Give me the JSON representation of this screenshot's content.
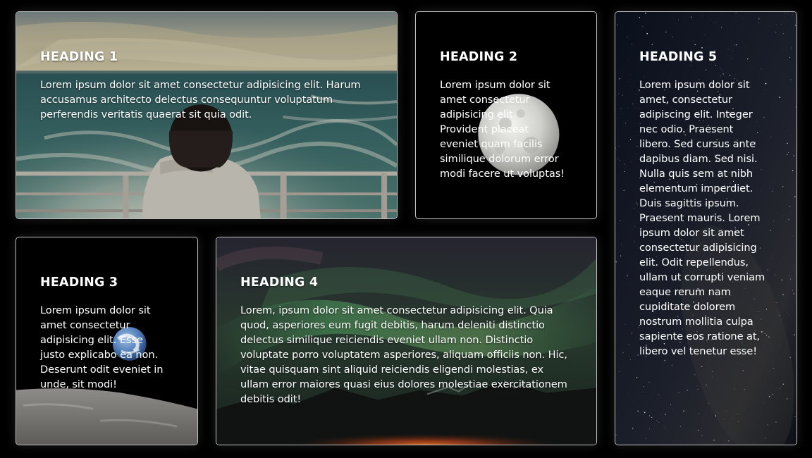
{
  "cards": [
    {
      "heading": "HEADING 1",
      "text": "Lorem ipsum dolor sit amet consectetur adipisicing elit. Harum accusamus architecto delectus consequuntur voluptatum perferendis veritatis quaerat sit quia odit."
    },
    {
      "heading": "HEADING 2",
      "text": "Lorem ipsum dolor sit amet consectetur adipisicing elit. Provident placeat eveniet quam facilis similique dolorum error modi facere ut voluptas!"
    },
    {
      "heading": "HEADING 3",
      "text": "Lorem ipsum dolor sit amet consectetur adipisicing elit. Esse justo explicabo ea non. Deserunt odit eveniet in unde, sit modi!"
    },
    {
      "heading": "HEADING 4",
      "text": "Lorem, ipsum dolor sit amet consectetur adipisicing elit. Quia quod, asperiores eum fugit debitis, harum deleniti distinctio delectus similique reiciendis eveniet ullam non. Distinctio voluptate porro voluptatem asperiores, aliquam officiis non. Hic, vitae quisquam sint aliquid reiciendis eligendi molestias, ex ullam error maiores quasi eius dolores molestiae exercitationem debitis odit!"
    },
    {
      "heading": "HEADING 5",
      "text": "Lorem ipsum dolor sit amet, consectetur adipiscing elit. Integer nec odio. Praesent libero. Sed cursus ante dapibus diam. Sed nisi. Nulla quis sem at nibh elementum imperdiet. Duis sagittis ipsum. Praesent mauris. Lorem ipsum dolor sit amet consectetur adipisicing elit. Odit repellendus, ullam ut corrupti veniam eaque rerum nam cupiditate dolorem nostrum mollitia culpa sapiente eos ratione at, libero vel tenetur esse!"
    }
  ],
  "colors": {
    "page_background": "#000000",
    "card_border": "#ffffff",
    "text": "#ffffff"
  }
}
